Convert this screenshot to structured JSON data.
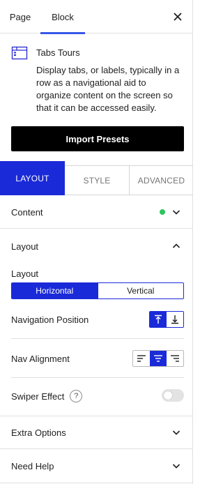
{
  "header": {
    "tabs": [
      {
        "label": "Page"
      },
      {
        "label": "Block"
      }
    ],
    "close_icon": "close-icon"
  },
  "block": {
    "icon": "tabs-block-icon",
    "title": "Tabs Tours",
    "description": "Display tabs, or labels, typically in a row as a navigational aid to organize content on the screen so that it can be accessed easily."
  },
  "import_button": "Import Presets",
  "inspector_tabs": [
    {
      "label": "LAYOUT",
      "active": true
    },
    {
      "label": "STYLE",
      "active": false
    },
    {
      "label": "ADVANCED",
      "active": false
    }
  ],
  "panels": {
    "content": {
      "label": "Content",
      "status_color": "#2ec55e"
    },
    "layout": {
      "label": "Layout",
      "layout_label": "Layout",
      "layout_options": [
        "Horizontal",
        "Vertical"
      ],
      "layout_selected": "Horizontal",
      "nav_position_label": "Navigation Position",
      "nav_position_selected": "top",
      "nav_alignment_label": "Nav Alignment",
      "nav_alignment_selected": "center",
      "swiper_label": "Swiper Effect",
      "swiper_help": "?",
      "swiper_enabled": false
    },
    "extra_options": {
      "label": "Extra Options"
    },
    "need_help": {
      "label": "Need Help"
    }
  },
  "colors": {
    "accent": "#1a2ad8",
    "wp_blue": "#3858e9",
    "button_black": "#000000"
  }
}
